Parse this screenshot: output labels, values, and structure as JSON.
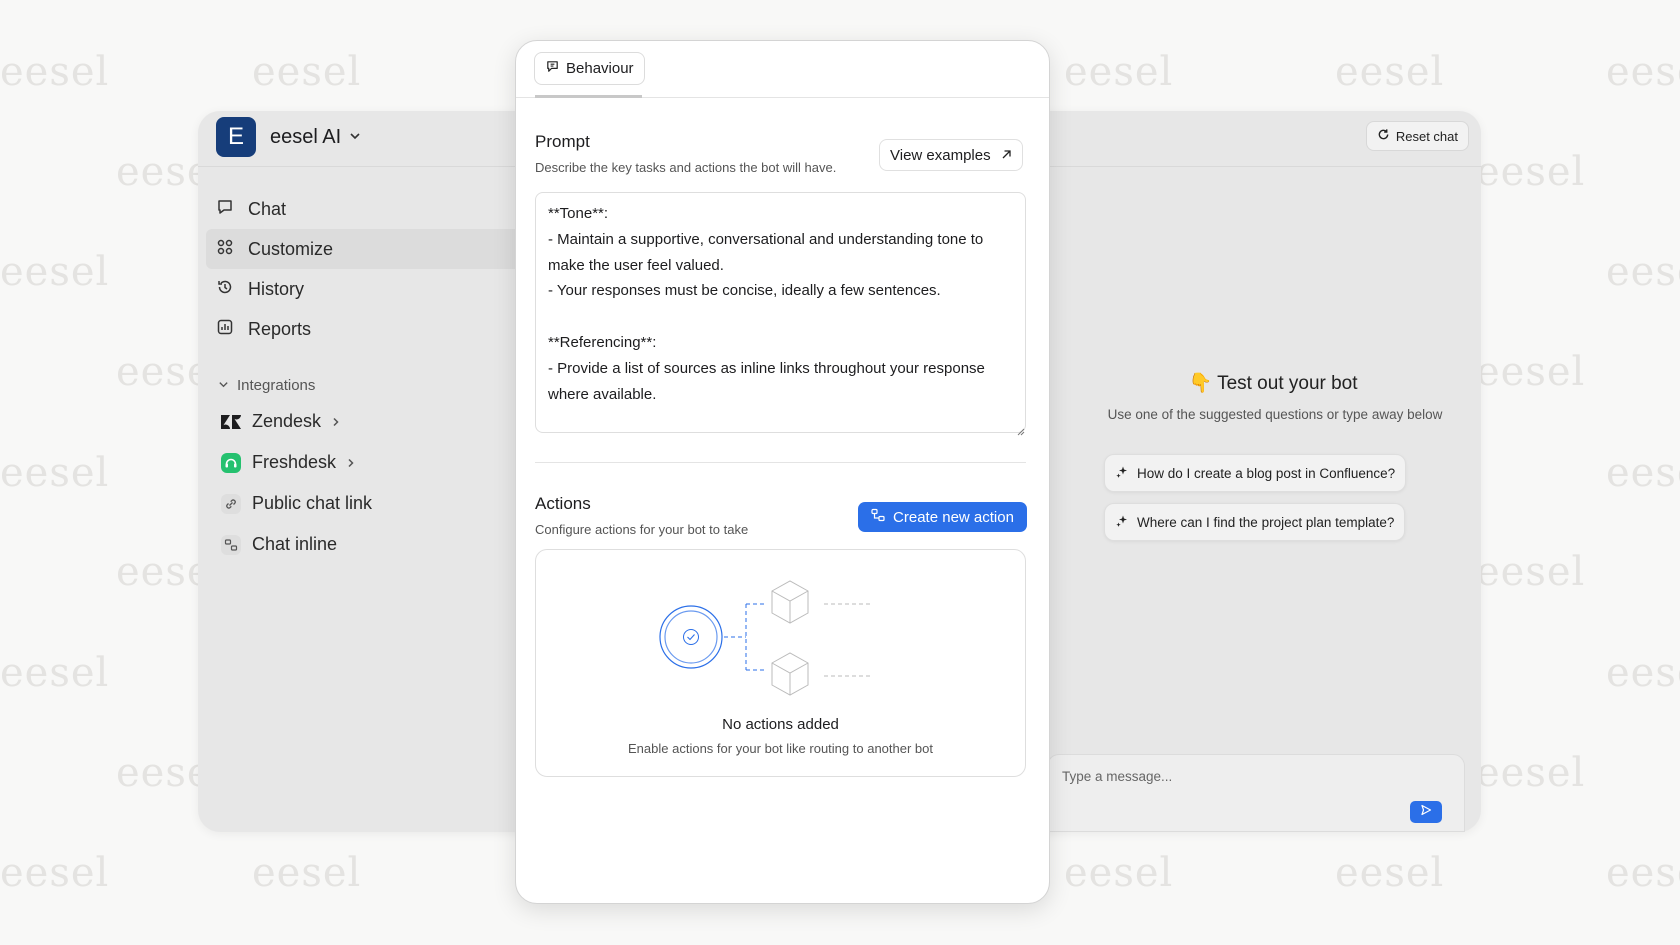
{
  "watermark": {
    "text": "eesel"
  },
  "workspace": {
    "initial": "E",
    "name": "eesel AI"
  },
  "nav": {
    "items": [
      {
        "label": "Chat"
      },
      {
        "label": "Customize"
      },
      {
        "label": "History"
      },
      {
        "label": "Reports"
      }
    ]
  },
  "integrations": {
    "heading": "Integrations",
    "items": [
      {
        "label": "Zendesk"
      },
      {
        "label": "Freshdesk"
      },
      {
        "label": "Public chat link"
      },
      {
        "label": "Chat inline"
      }
    ]
  },
  "chat": {
    "reset_label": "Reset chat",
    "emoji": "👇",
    "title": "Test out your bot",
    "subtitle": "Use one of the suggested questions or type away below",
    "suggestions": [
      {
        "label": "How do I create a blog post in Confluence?"
      },
      {
        "label": "Where can I find the project plan template?"
      }
    ],
    "input_placeholder": "Type a message..."
  },
  "panel": {
    "tab_label": "Behaviour",
    "prompt": {
      "title": "Prompt",
      "subtitle": "Describe the key tasks and actions the bot will have.",
      "examples_label": "View examples",
      "value": "**Tone**:\n- Maintain a supportive, conversational and understanding tone to make the user feel valued.\n- Your responses must be concise, ideally a few sentences.\n\n**Referencing**:\n- Provide a list of sources as inline links throughout your response where available."
    },
    "actions": {
      "title": "Actions",
      "subtitle": "Configure actions for your bot to take",
      "create_label": "Create new action",
      "empty_title": "No actions added",
      "empty_subtitle": "Enable actions for your bot like routing to another bot"
    }
  },
  "colors": {
    "accent": "#2b6fe8",
    "workspace_avatar": "#163d7a",
    "freshdesk": "#25c16f"
  }
}
